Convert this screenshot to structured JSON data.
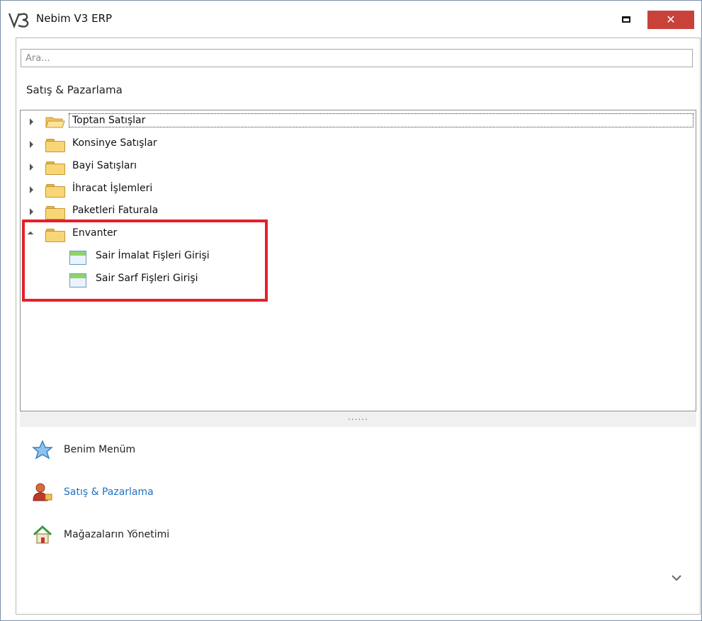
{
  "window": {
    "logo_text": "V3",
    "title": "Nebim V3 ERP",
    "close_symbol": "✕",
    "maximize_icon": "maximize-icon"
  },
  "search": {
    "placeholder": "Ara..."
  },
  "section_title": "Satış & Pazarlama",
  "tree": {
    "items": [
      {
        "label": "Toptan Satışlar",
        "expanded": false,
        "selected": true,
        "icon": "folder-open-icon"
      },
      {
        "label": "Konsinye Satışlar",
        "expanded": false,
        "icon": "folder-icon"
      },
      {
        "label": "Bayi Satışları",
        "expanded": false,
        "icon": "folder-icon"
      },
      {
        "label": "İhracat İşlemleri",
        "expanded": false,
        "icon": "folder-icon"
      },
      {
        "label": "Paketleri Faturala",
        "expanded": false,
        "icon": "folder-icon"
      },
      {
        "label": "Envanter",
        "expanded": true,
        "icon": "folder-icon",
        "children": [
          {
            "label": "Sair İmalat Fişleri Girişi",
            "icon": "form-icon"
          },
          {
            "label": "Sair Sarf Fişleri Girişi",
            "icon": "form-icon"
          }
        ]
      }
    ],
    "highlight_color": "#e3212a"
  },
  "splitter_grip": "......",
  "nav": {
    "items": [
      {
        "label": "Benim Menüm",
        "icon": "star-icon",
        "active": false
      },
      {
        "label": "Satış & Pazarlama",
        "icon": "user-icon",
        "active": true
      },
      {
        "label": "Mağazaların Yönetimi",
        "icon": "home-icon",
        "active": false
      }
    ],
    "active_color": "#1f6fc1",
    "more_icon": "chevron-down-icon"
  }
}
